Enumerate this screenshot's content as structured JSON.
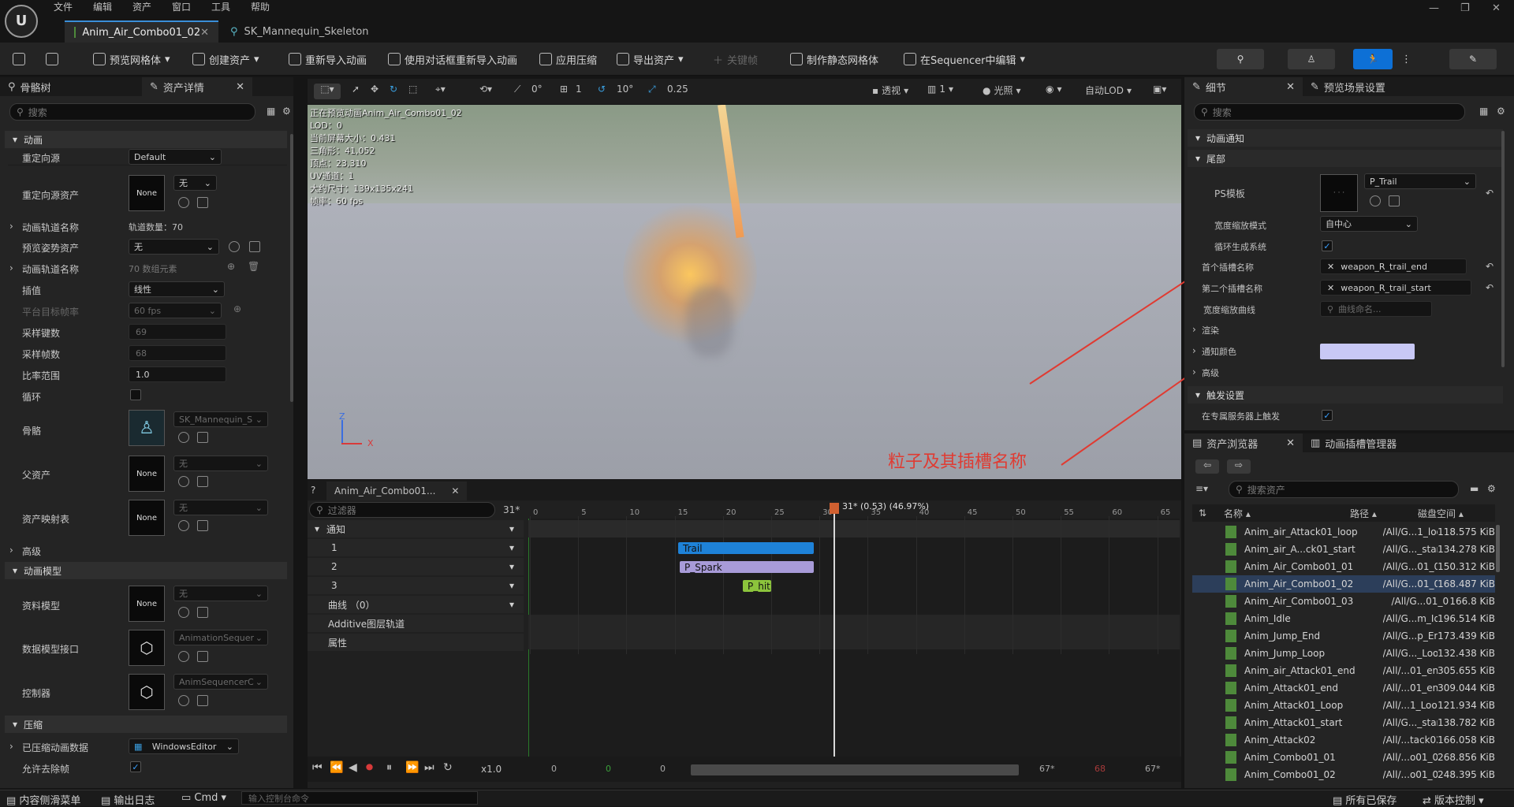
{
  "menubar": {
    "items": [
      "文件",
      "编辑",
      "资产",
      "窗口",
      "工具",
      "帮助"
    ]
  },
  "tabs": [
    {
      "label": "Anim_Air_Combo01_02"
    },
    {
      "label": "SK_Mannequin_Skeleton"
    }
  ],
  "toolbar": {
    "save": "保存",
    "items": [
      "预览网格体",
      "创建资产",
      "重新导入动画",
      "使用对话框重新导入动画",
      "应用压缩",
      "导出资产",
      "关键帧",
      "制作静态网格体",
      "在Sequencer中编辑"
    ]
  },
  "left_panel": {
    "tabs": [
      "骨骼树",
      "资产详情"
    ],
    "search_placeholder": "搜索",
    "sections": {
      "anim": "动画",
      "advanced": "高级",
      "anim_model": "动画模型",
      "compress": "压缩"
    },
    "props": {
      "retarget_src": {
        "label": "重定向源",
        "value": "Default"
      },
      "retarget_asset": {
        "label": "重定向源资产",
        "thumb": "None",
        "value": "无"
      },
      "track_names": {
        "label": "动画轨道名称",
        "value": "轨道数量：70"
      },
      "preview_pose": {
        "label": "预览姿势资产",
        "value": "无"
      },
      "track_names2": {
        "label": "动画轨道名称",
        "value": "70 数组元素"
      },
      "interp": {
        "label": "插值",
        "value": "线性"
      },
      "platform_rate": {
        "label": "平台目标帧率",
        "value": "60 fps"
      },
      "sample_keys": {
        "label": "采样键数",
        "value": "69"
      },
      "sample_frames": {
        "label": "采样帧数",
        "value": "68"
      },
      "rate_scale": {
        "label": "比率范围",
        "value": "1.0"
      },
      "loop": {
        "label": "循环"
      },
      "skeleton": {
        "label": "骨骼",
        "value": "SK_Mannequin_S"
      },
      "parent": {
        "label": "父资产",
        "thumb": "None",
        "value": "无"
      },
      "asset_map": {
        "label": "资产映射表",
        "thumb": "None",
        "value": "无"
      },
      "data_model": {
        "label": "资料模型",
        "thumb": "None",
        "value": "无"
      },
      "data_iface": {
        "label": "数据模型接口",
        "value": "AnimationSequer"
      },
      "controller": {
        "label": "控制器",
        "value": "AnimSequencerC"
      },
      "compressed": {
        "label": "已压缩动画数据",
        "value": "WindowsEditor"
      },
      "allow_strip": {
        "label": "允许去除帧"
      }
    }
  },
  "viewport": {
    "toolbar": {
      "snap": "0°",
      "grid": "1",
      "rot": "10°",
      "scale": "0.25",
      "view": "透视",
      "view_n": "1",
      "light": "光照",
      "lod": "自动LOD"
    },
    "stats": [
      "正在预览动画Anim_Air_Combo01_02",
      "LOD：0",
      "当前屏幕大小：0.431",
      "三角形：41,052",
      "顶点：23,310",
      "UV通道：1",
      "大约尺寸：139x135x241",
      "帧率：60 fps"
    ],
    "axis_z": "Z",
    "axis_x": "X"
  },
  "annotation": "粒子及其插槽名称",
  "timeline": {
    "tab": "Anim_Air_Combo01...",
    "filter_placeholder": "过滤器",
    "frame": "31*",
    "playhead": "31* (0.53) (46.97%)",
    "ticks": [
      "0",
      "5",
      "10",
      "15",
      "20",
      "25",
      "30",
      "35",
      "40",
      "45",
      "50",
      "55",
      "60",
      "65"
    ],
    "tracks": [
      "通知",
      "1",
      "2",
      "3",
      "曲线 （0）",
      "Additive图层轨道",
      "属性"
    ],
    "notifies": [
      "Trail",
      "P_Spark",
      "P_hit"
    ],
    "speed": "x1.0",
    "bottom": [
      "0",
      "0",
      "0",
      "67*",
      "68",
      "67*"
    ]
  },
  "details": {
    "tabs": [
      "细节",
      "预览场景设置"
    ],
    "search_placeholder": "搜索",
    "sections": {
      "notify": "动画通知",
      "trail": "尾部",
      "render": "渲染",
      "advanced": "高级",
      "trigger": "触发设置"
    },
    "props": {
      "ps_template": {
        "label": "PS模板",
        "value": "P_Trail"
      },
      "width_mode": {
        "label": "宽度缩放模式",
        "value": "自中心"
      },
      "recycle": {
        "label": "循环生成系统"
      },
      "first_socket": {
        "label": "首个插槽名称",
        "value": "weapon_R_trail_end"
      },
      "second_socket": {
        "label": "第二个插槽名称",
        "value": "weapon_R_trail_start"
      },
      "width_curve": {
        "label": "宽度缩放曲线",
        "placeholder": "曲线命名..."
      },
      "notify_color": {
        "label": "通知颜色",
        "color": "#c8c8f5"
      },
      "dedicated": {
        "label": "在专属服务器上触发"
      }
    }
  },
  "asset_browser": {
    "tabs": [
      "资产浏览器",
      "动画插槽管理器"
    ],
    "search_placeholder": "搜索资产",
    "cols": [
      "名称",
      "路径",
      "磁盘空间"
    ],
    "rows": [
      {
        "name": "Anim_air_Attack01_loop",
        "path": "/All/G...1_loop",
        "size": "118.575 KiB"
      },
      {
        "name": "Anim_air_A...ck01_start",
        "path": "/All/G..._start",
        "size": "134.278 KiB"
      },
      {
        "name": "Anim_Air_Combo01_01",
        "path": "/All/G...01_01",
        "size": "150.312 KiB"
      },
      {
        "name": "Anim_Air_Combo01_02",
        "path": "/All/G...01_02",
        "size": "168.487 KiB",
        "selected": true
      },
      {
        "name": "Anim_Air_Combo01_03",
        "path": "/All/G...01_03",
        "size": "166.8 KiB"
      },
      {
        "name": "Anim_Idle",
        "path": "/All/G...m_Idle",
        "size": "196.514 KiB"
      },
      {
        "name": "Anim_Jump_End",
        "path": "/All/G...p_End",
        "size": "173.439 KiB"
      },
      {
        "name": "Anim_Jump_Loop",
        "path": "/All/G..._Loop",
        "size": "132.438 KiB"
      },
      {
        "name": "Anim_air_Attack01_end",
        "path": "/All/...01_end",
        "size": "305.655 KiB"
      },
      {
        "name": "Anim_Attack01_end",
        "path": "/All/...01_end",
        "size": "309.044 KiB"
      },
      {
        "name": "Anim_Attack01_Loop",
        "path": "/All/...1_Loop",
        "size": "121.934 KiB"
      },
      {
        "name": "Anim_Attack01_start",
        "path": "/All/G..._start",
        "size": "138.782 KiB"
      },
      {
        "name": "Anim_Attack02",
        "path": "/All/...tack02",
        "size": "166.058 KiB"
      },
      {
        "name": "Anim_Combo01_01",
        "path": "/All/...o01_01",
        "size": "268.856 KiB"
      },
      {
        "name": "Anim_Combo01_02",
        "path": "/All/...o01_02",
        "size": "248.395 KiB"
      }
    ]
  },
  "statusbar": {
    "drawer": "内容侧滑菜单",
    "log": "输出日志",
    "cmd": "Cmd",
    "cmd_placeholder": "输入控制台命令",
    "saved": "所有已保存",
    "vc": "版本控制"
  },
  "colors": {
    "accent": "#0d70d6",
    "trail": "#1e82d8",
    "spark": "#a89bd8",
    "hit": "#8cc43c",
    "annotation": "#e03b32"
  }
}
